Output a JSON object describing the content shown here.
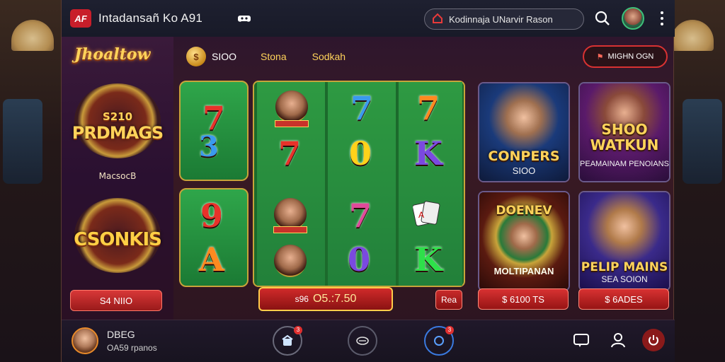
{
  "header": {
    "logo": "AF",
    "title": "Intadansañ Ko A91",
    "promo_text": "Kodinnaja UNarvir  Rason"
  },
  "left_panel": {
    "brand": "Jhoaltow",
    "emblem1_top": "S210",
    "emblem1_main": "PRDMAGS",
    "emblem1_sub": "MacsocB",
    "emblem2_main": "CSONKIS",
    "button": "S4 NIIO"
  },
  "game_header": {
    "balance": "SIOO",
    "tab1": "Stona",
    "tab2": "Sodkah"
  },
  "reels": {
    "symbols": [
      {
        "text": "7",
        "color": "red"
      },
      {
        "text": "3",
        "color": "blue"
      },
      {
        "text": "9",
        "color": "red"
      },
      {
        "text": "A",
        "color": "orange"
      },
      {
        "text": "7",
        "color": "red"
      },
      {
        "text": "7",
        "color": "blue"
      },
      {
        "text": "0",
        "color": "yellow"
      },
      {
        "text": "7",
        "color": "pink"
      },
      {
        "text": "0",
        "color": "purple"
      },
      {
        "text": "7",
        "color": "orange"
      },
      {
        "text": "K",
        "color": "purple"
      },
      {
        "text": "K",
        "color": "green"
      }
    ]
  },
  "spin": {
    "prefix": "s96",
    "amount": "O5.:7.50",
    "small_btn": "Rea"
  },
  "right_panel": {
    "top_button": "MIGHN OGN",
    "cards": [
      {
        "title": "CONPERS",
        "sub": "SIOO"
      },
      {
        "title": "SHOO WATKUN",
        "sub": "PEAMAINAM PENOIANS"
      },
      {
        "title": "DOENEV",
        "sub": "MOLTIPANAN"
      },
      {
        "title": "PELIP MAINS",
        "sub": "SEA SOION"
      }
    ],
    "card_button_1": "$ 6100 TS",
    "card_button_2": "$ 6ADES"
  },
  "bottom": {
    "user_name": "DBEG",
    "user_meta": "OA59 rpanos",
    "badge1": "3",
    "badge2": "3"
  },
  "colors": {
    "accent": "#c81e2a",
    "gold": "#ffd35a",
    "reel_green": "#2fa64a"
  }
}
